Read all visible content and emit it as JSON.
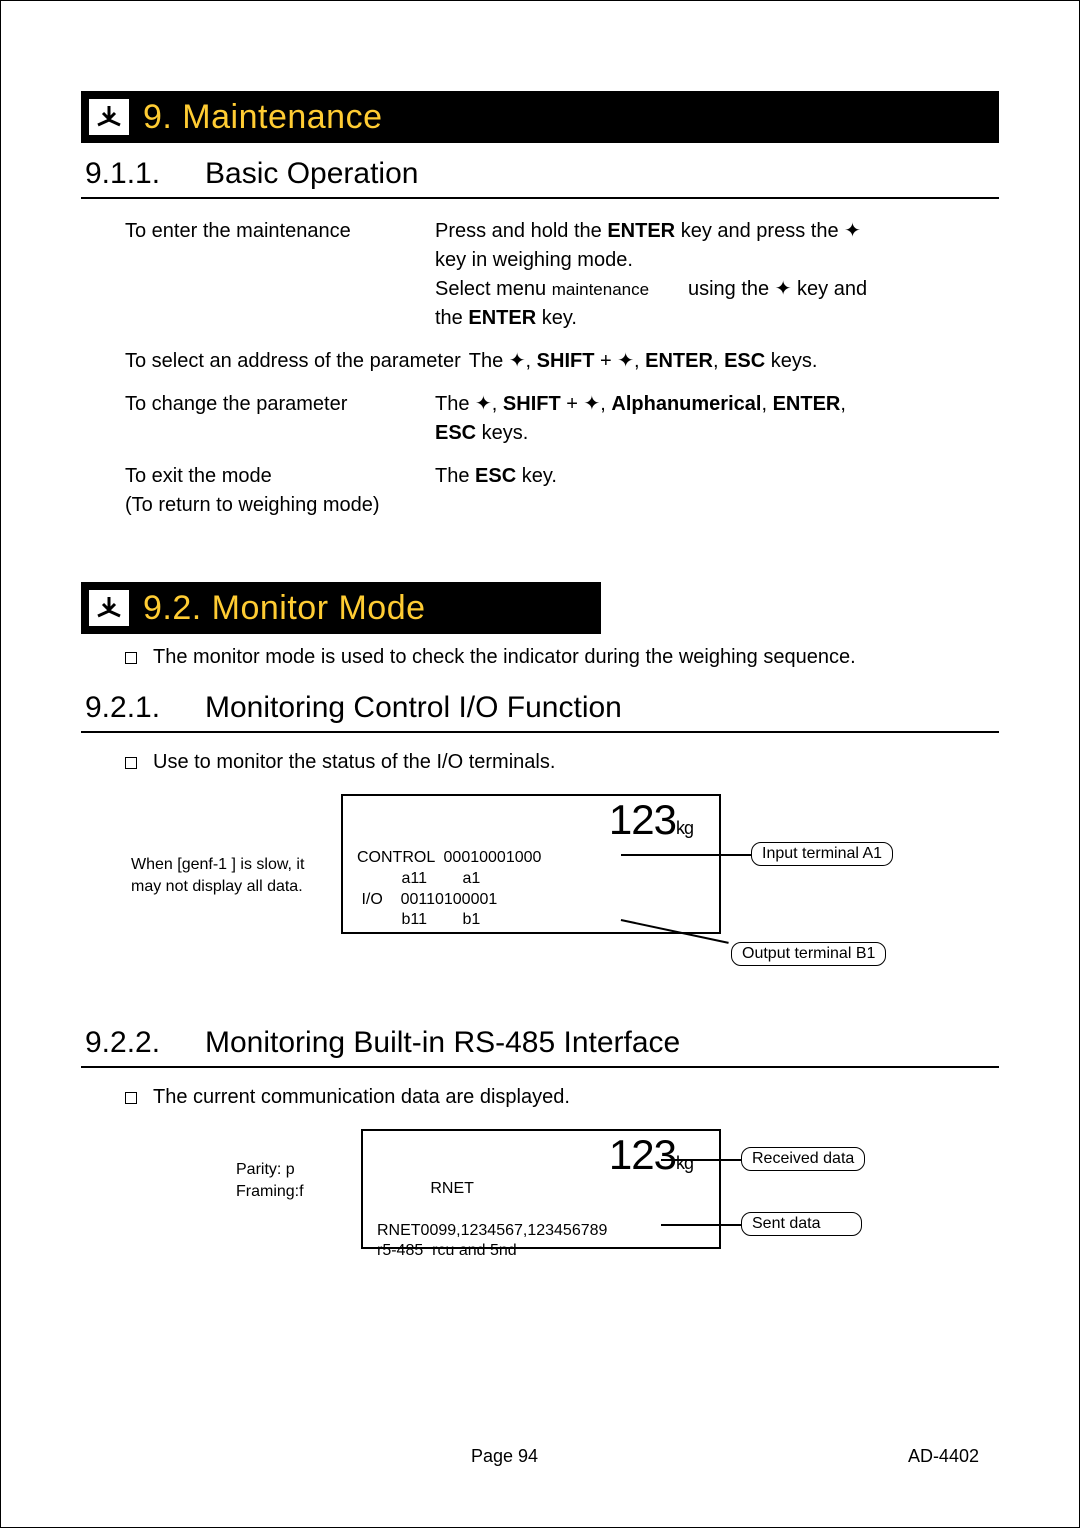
{
  "banner1": {
    "title": "9. Maintenance"
  },
  "section911": {
    "num": "9.1.1.",
    "title": "Basic Operation"
  },
  "ops": {
    "r1_left": "To enter the maintenance",
    "r1_rt1a": "Press and hold the ",
    "r1_rt1b": "ENTER",
    "r1_rt1c": " key and press the ",
    "r1_rt1d": "key in weighing mode.",
    "r1_rt2a": "Select menu ",
    "r1_rt2b": "maintenance",
    "r1_rt2c": "using the ",
    "r1_rt2d": " key and",
    "r1_rt3a": "the ",
    "r1_rt3b": "ENTER",
    "r1_rt3c": " key.",
    "r2_left": "To select an address of the parameter",
    "r2_rt_a": "The ",
    "r2_rt_b": "SHIFT",
    "r2_rt_c": "ENTER",
    "r2_rt_d": "ESC",
    "r2_rt_e": " keys.",
    "r3_left": "To change the parameter",
    "r3_rt_a": "The ",
    "r3_rt_b": "SHIFT",
    "r3_rt_c": "Alphanumerical",
    "r3_rt_d": "ENTER",
    "r3_rt_e": "ESC",
    "r3_rt_f": " keys.",
    "r4_left1": "To exit the mode",
    "r4_left2": "(To return to weighing mode)",
    "r4_rt_a": "The ",
    "r4_rt_b": "ESC",
    "r4_rt_c": " key."
  },
  "banner2": {
    "title": "9.2. Monitor Mode"
  },
  "note92": "The monitor mode is used to check the indicator during the weighing sequence.",
  "section921": {
    "num": "9.2.1.",
    "title": "Monitoring Control I/O Function"
  },
  "note921": "Use to monitor the status of the I/O terminals.",
  "diag1": {
    "caption1": "When [genf-1  ] is slow, it",
    "caption2": "may not display all data.",
    "big": "123",
    "unit": "kg",
    "l1": "CONTROL  00010001000",
    "l2": "          a11        a1",
    "l3": " I/O    00110100001",
    "l4": "          b11        b1",
    "call1": "Input terminal A1",
    "call2": "Output terminal B1"
  },
  "section922": {
    "num": "9.2.2.",
    "title": "Monitoring Built-in RS-485 Interface"
  },
  "note922": "The current communication data are displayed.",
  "diag2": {
    "caption1": "Parity: p",
    "caption2": "Framing:f",
    "big": "123",
    "unit": "kg",
    "l1": "            RNET",
    "l2": "RNET0099,1234567,123456789",
    "l3": "r5-485  rcu and 5nd",
    "call1": "Received data",
    "call2": "Sent data"
  },
  "footer": {
    "center": "Page 94",
    "right": "AD-4402"
  }
}
